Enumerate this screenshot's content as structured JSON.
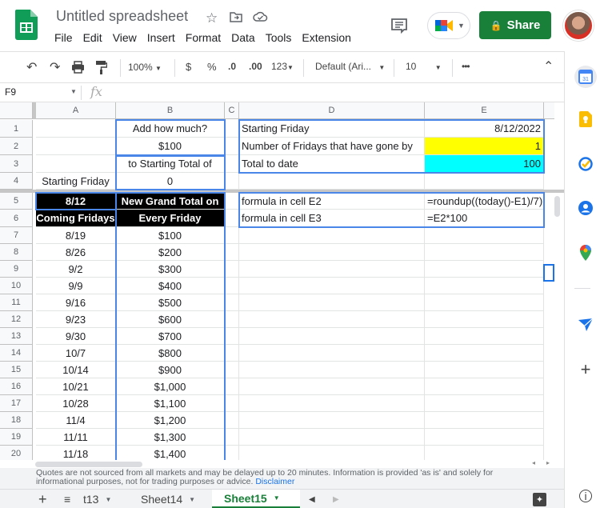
{
  "app": {
    "title": "Untitled spreadsheet",
    "menu": [
      "File",
      "Edit",
      "View",
      "Insert",
      "Format",
      "Data",
      "Tools",
      "Extension"
    ],
    "share_label": "Share"
  },
  "toolbar": {
    "zoom": "100%",
    "currency": "$",
    "percent": "%",
    "dec_less": ".0",
    "dec_more": ".00",
    "format_more": "123",
    "font": "Default (Ari...",
    "font_size": "10",
    "more": "•••"
  },
  "formula_bar": {
    "namebox": "F9",
    "fx": "fx",
    "content": ""
  },
  "columns": [
    "A",
    "B",
    "C",
    "D",
    "E"
  ],
  "rows": [
    "1",
    "2",
    "3",
    "4",
    "5",
    "6",
    "7",
    "8",
    "9",
    "10",
    "11",
    "12",
    "13",
    "14",
    "15",
    "16",
    "17",
    "18",
    "19",
    "20"
  ],
  "cells": {
    "B1": "Add how much?",
    "B2": "$100",
    "B3": "to Starting Total of",
    "B4": "0",
    "A4": "Starting Friday",
    "A5": "8/12",
    "A6": "Coming Fridays",
    "B5": "New Grand Total on",
    "B6": "Every Friday",
    "D1": "Starting Friday",
    "E1": "8/12/2022",
    "D2": "Number of Fridays that have gone by",
    "E2": "1",
    "D3": "Total to date",
    "E3": "100",
    "D5": "formula in cell E2",
    "E5": "=roundup((today()-E1)/7)",
    "D6": "formula in cell E3",
    "E6": "=E2*100"
  },
  "fridays": [
    {
      "date": "8/19",
      "total": "$100"
    },
    {
      "date": "8/26",
      "total": "$200"
    },
    {
      "date": "9/2",
      "total": "$300"
    },
    {
      "date": "9/9",
      "total": "$400"
    },
    {
      "date": "9/16",
      "total": "$500"
    },
    {
      "date": "9/23",
      "total": "$600"
    },
    {
      "date": "9/30",
      "total": "$700"
    },
    {
      "date": "10/7",
      "total": "$800"
    },
    {
      "date": "10/14",
      "total": "$900"
    },
    {
      "date": "10/21",
      "total": "$1,000"
    },
    {
      "date": "10/28",
      "total": "$1,100"
    },
    {
      "date": "11/4",
      "total": "$1,200"
    },
    {
      "date": "11/11",
      "total": "$1,300"
    },
    {
      "date": "11/18",
      "total": "$1,400"
    }
  ],
  "disclaimer": {
    "text": "Quotes are not sourced from all markets and may be delayed up to 20 minutes. Information is provided 'as is' and solely for informational purposes, not for trading purposes or advice.",
    "link": "Disclaimer"
  },
  "sheets": {
    "partial": "t13",
    "sheet14": "Sheet14",
    "active": "Sheet15"
  },
  "colors": {
    "share": "#188038",
    "highlight_yellow": "#ffff00",
    "highlight_cyan": "#00ffff",
    "border_blue": "#4a86e8"
  }
}
